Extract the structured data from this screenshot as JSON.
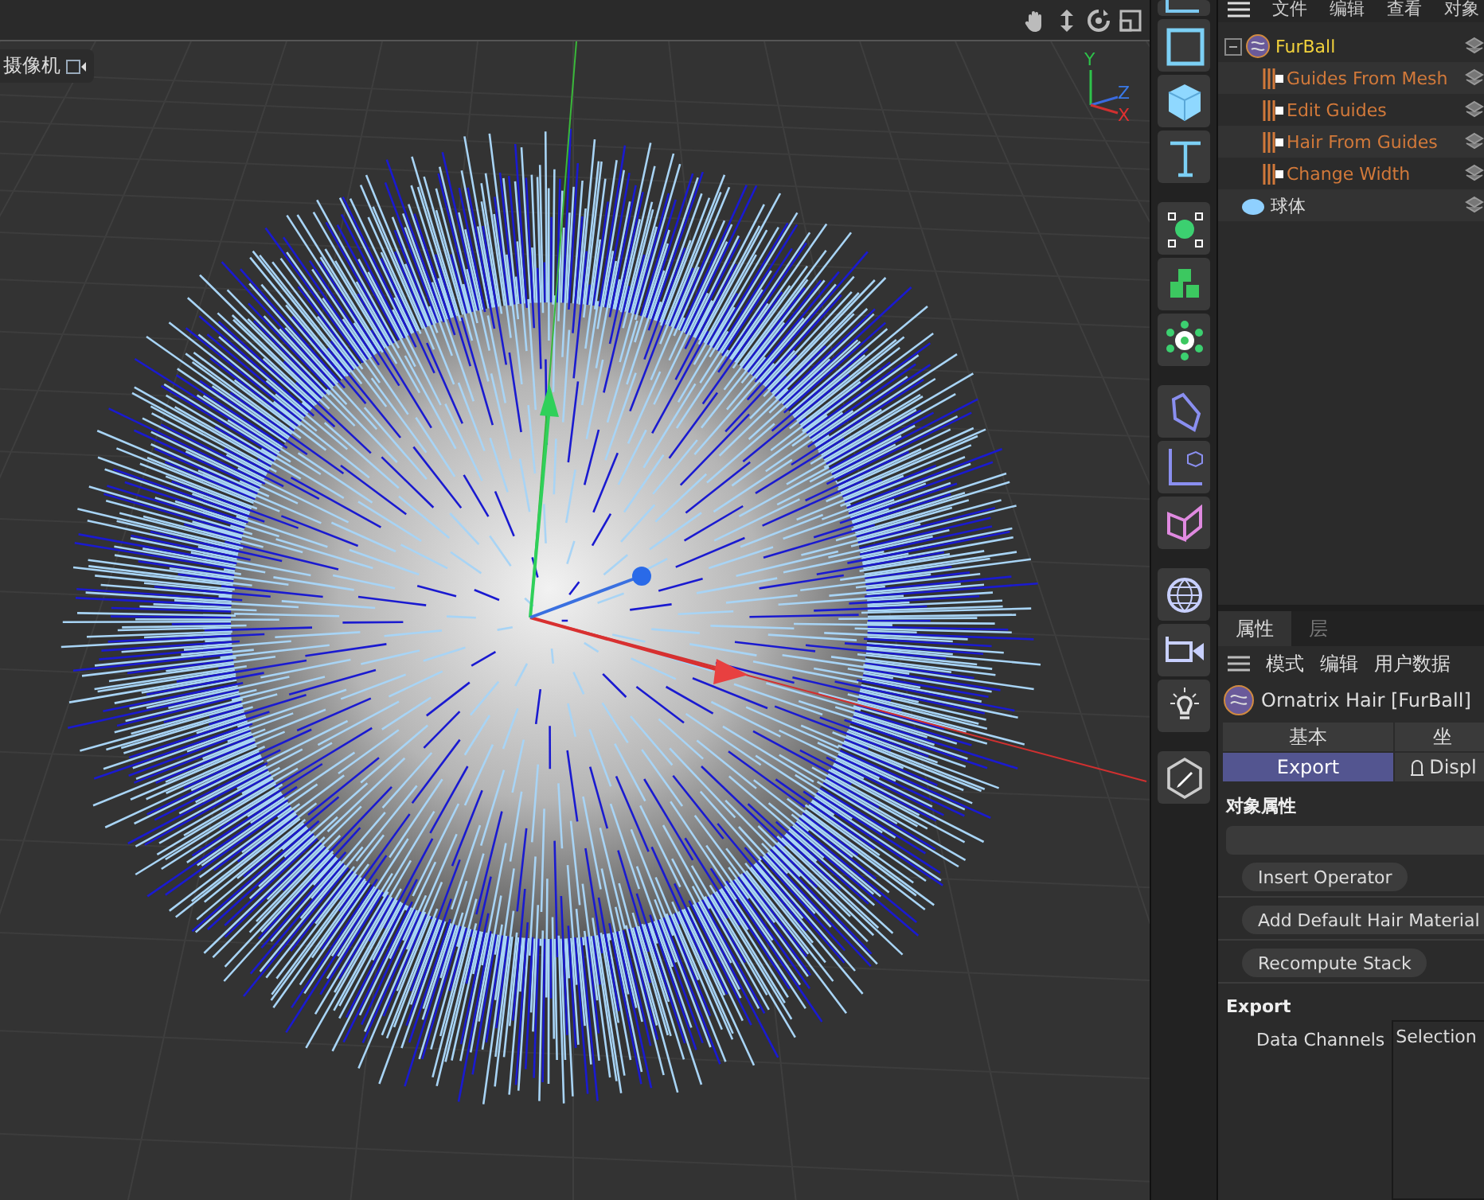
{
  "viewport": {
    "camera_label": "摄像机",
    "axis_labels": [
      "Y",
      "Z",
      "X"
    ]
  },
  "object_manager": {
    "menu": [
      "文件",
      "编辑",
      "查看",
      "对象"
    ],
    "tree": [
      {
        "name": "FurBall",
        "kind": "hair",
        "expanded": true,
        "children": [
          {
            "name": "Guides From Mesh",
            "kind": "operator"
          },
          {
            "name": "Edit Guides",
            "kind": "operator"
          },
          {
            "name": "Hair From Guides",
            "kind": "operator"
          },
          {
            "name": "Change Width",
            "kind": "operator"
          }
        ]
      },
      {
        "name": "球体",
        "kind": "sphere"
      }
    ]
  },
  "attributes": {
    "tabs": [
      {
        "label": "属性",
        "selected": true
      },
      {
        "label": "层",
        "selected": false
      }
    ],
    "menu": [
      "模式",
      "编辑",
      "用户数据"
    ],
    "object_title": "Ornatrix Hair [FurBall]",
    "page_tabs": [
      {
        "label": "基本",
        "selected": false
      },
      {
        "label": "坐",
        "selected": false
      },
      {
        "label": "Export",
        "selected": true
      },
      {
        "label": "Displ",
        "selected": false,
        "icon": true
      }
    ],
    "section": "对象属性",
    "buttons": [
      "Insert Operator",
      "Add Default Hair Material",
      "Recompute Stack"
    ],
    "export_heading": "Export",
    "data_channels": {
      "label": "Data Channels",
      "items": [
        "Selection"
      ]
    }
  }
}
